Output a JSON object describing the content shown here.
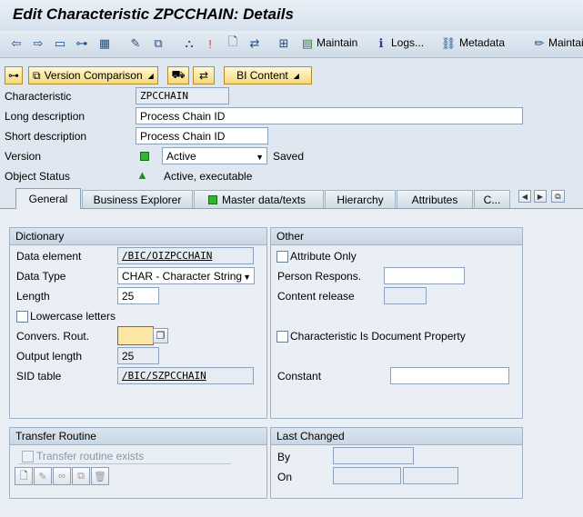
{
  "title": "Edit Characteristic ZPCCHAIN: Details",
  "toolbar": {
    "maintain_label": "Maintain",
    "logs_label": "Logs...",
    "metadata_label": "Metadata",
    "maintain2_label": "Maintai"
  },
  "appbar": {
    "version_comparison": "Version Comparison",
    "bi_content": "BI Content"
  },
  "header": {
    "characteristic_label": "Characteristic",
    "characteristic_value": "ZPCCHAIN",
    "long_desc_label": "Long description",
    "long_desc_value": "Process Chain ID",
    "short_desc_label": "Short description",
    "short_desc_value": "Process Chain ID",
    "version_label": "Version",
    "version_value": "Active",
    "version_status": "Saved",
    "object_status_label": "Object Status",
    "object_status_value": "Active, executable"
  },
  "tabs": [
    {
      "label": "General"
    },
    {
      "label": "Business Explorer"
    },
    {
      "label": "Master data/texts"
    },
    {
      "label": "Hierarchy"
    },
    {
      "label": "Attributes"
    },
    {
      "label": "C..."
    }
  ],
  "dictionary": {
    "title": "Dictionary",
    "data_element_label": "Data element",
    "data_element_value": "/BIC/OIZPCCHAIN",
    "data_type_label": "Data Type",
    "data_type_value": "CHAR - Character String",
    "length_label": "Length",
    "length_value": "25",
    "lowercase_label": "Lowercase letters",
    "convers_label": "Convers. Rout.",
    "convers_value": "",
    "output_length_label": "Output length",
    "output_length_value": "25",
    "sid_label": "SID table",
    "sid_value": "/BIC/SZPCCHAIN"
  },
  "other": {
    "title": "Other",
    "attribute_only_label": "Attribute Only",
    "person_respons_label": "Person Respons.",
    "content_release_label": "Content release",
    "doc_property_label": "Characteristic Is Document Property",
    "constant_label": "Constant"
  },
  "transfer": {
    "title": "Transfer Routine",
    "exists_label": "Transfer routine exists"
  },
  "last_changed": {
    "title": "Last Changed",
    "by_label": "By",
    "on_label": "On"
  },
  "colors": {
    "accent_yellow": "#f4d97a",
    "status_green": "#2db82d",
    "bg": "#dfe7f0"
  }
}
